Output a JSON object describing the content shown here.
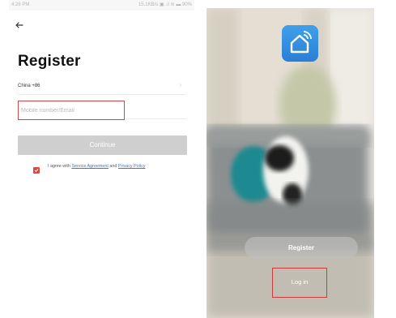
{
  "left_screen": {
    "status_bar": {
      "time": "4:26 PM",
      "right_info": "15.1KB/s ▣ .ıl ≋ ▬ 90%"
    },
    "title": "Register",
    "country_code": "China +86",
    "country_chevron": "›",
    "mobile_input": {
      "placeholder": "Mobile number/Email",
      "value": ""
    },
    "continue_label": "Continue",
    "agreement": {
      "checked": true,
      "prefix": "I agree with ",
      "service_link": "Service Agreement",
      "middle": " and ",
      "privacy_link": "Privacy Policy"
    }
  },
  "right_screen": {
    "register_label": "Register",
    "login_label": "Log in"
  },
  "colors": {
    "checkbox": "#d94b3f",
    "link": "#3d74c9",
    "highlight_box": "#d64545",
    "continue_disabled": "#cfcfcf",
    "logo_blue": "#2a7fd4"
  }
}
